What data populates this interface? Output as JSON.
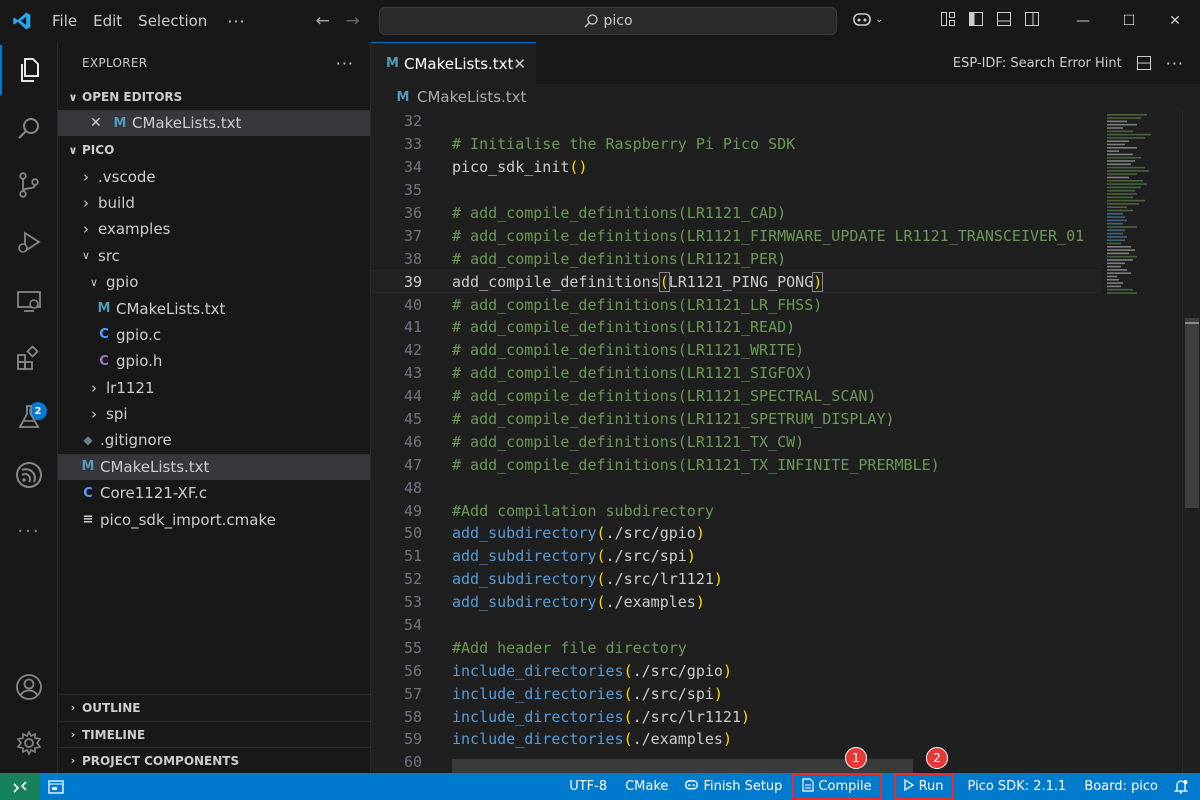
{
  "menu": {
    "file": "File",
    "edit": "Edit",
    "selection": "Selection",
    "more": "···"
  },
  "search": {
    "text": "pico"
  },
  "explorer": {
    "title": "EXPLORER",
    "open_editors": {
      "label": "OPEN EDITORS",
      "items": [
        {
          "name": "CMakeLists.txt",
          "icon": "M"
        }
      ]
    },
    "workspace": {
      "label": "PICO",
      "tree": [
        {
          "name": ".vscode",
          "type": "folder",
          "depth": 0,
          "expanded": false
        },
        {
          "name": "build",
          "type": "folder",
          "depth": 0,
          "expanded": false
        },
        {
          "name": "examples",
          "type": "folder",
          "depth": 0,
          "expanded": false
        },
        {
          "name": "src",
          "type": "folder",
          "depth": 0,
          "expanded": true
        },
        {
          "name": "gpio",
          "type": "folder",
          "depth": 1,
          "expanded": true
        },
        {
          "name": "CMakeLists.txt",
          "type": "file",
          "icon": "M",
          "depth": 2
        },
        {
          "name": "gpio.c",
          "type": "file",
          "icon": "C",
          "depth": 2
        },
        {
          "name": "gpio.h",
          "type": "file",
          "icon": "C",
          "depth": 2
        },
        {
          "name": "lr1121",
          "type": "folder",
          "depth": 1,
          "expanded": false
        },
        {
          "name": "spi",
          "type": "folder",
          "depth": 1,
          "expanded": false
        },
        {
          "name": ".gitignore",
          "type": "file",
          "icon": "git",
          "depth": 0
        },
        {
          "name": "CMakeLists.txt",
          "type": "file",
          "icon": "M",
          "depth": 0,
          "selected": true
        },
        {
          "name": "Core1121-XF.c",
          "type": "file",
          "icon": "C",
          "depth": 0
        },
        {
          "name": "pico_sdk_import.cmake",
          "type": "file",
          "icon": "list",
          "depth": 0
        }
      ]
    },
    "outline": "OUTLINE",
    "timeline": "TIMELINE",
    "project_components": "PROJECT COMPONENTS"
  },
  "editor": {
    "tab": {
      "label": "CMakeLists.txt",
      "icon": "M"
    },
    "esp_hint": "ESP-IDF: Search Error Hint",
    "breadcrumb": "CMakeLists.txt",
    "lines": [
      {
        "n": "32",
        "t": ""
      },
      {
        "n": "33",
        "t": "# Initialise the Raspberry Pi Pico SDK",
        "k": "comment"
      },
      {
        "n": "34",
        "t": "pico_sdk_init()",
        "k": "call",
        "fn": "pico_sdk_init",
        "arg": ""
      },
      {
        "n": "35",
        "t": ""
      },
      {
        "n": "36",
        "t": "# add_compile_definitions(LR1121_CAD)",
        "k": "comment"
      },
      {
        "n": "37",
        "t": "# add_compile_definitions(LR1121_FIRMWARE_UPDATE LR1121_TRANSCEIVER_01",
        "k": "comment"
      },
      {
        "n": "38",
        "t": "# add_compile_definitions(LR1121_PER)",
        "k": "comment"
      },
      {
        "n": "39",
        "t": "add_compile_definitions(LR1121_PING_PONG)",
        "k": "call",
        "fn": "add_compile_definitions",
        "arg": "LR1121_PING_PONG",
        "current": true
      },
      {
        "n": "40",
        "t": "# add_compile_definitions(LR1121_LR_FHSS)",
        "k": "comment"
      },
      {
        "n": "41",
        "t": "# add_compile_definitions(LR1121_READ)",
        "k": "comment"
      },
      {
        "n": "42",
        "t": "# add_compile_definitions(LR1121_WRITE)",
        "k": "comment"
      },
      {
        "n": "43",
        "t": "# add_compile_definitions(LR1121_SIGFOX)",
        "k": "comment"
      },
      {
        "n": "44",
        "t": "# add_compile_definitions(LR1121_SPECTRAL_SCAN)",
        "k": "comment"
      },
      {
        "n": "45",
        "t": "# add_compile_definitions(LR1121_SPETRUM_DISPLAY)",
        "k": "comment"
      },
      {
        "n": "46",
        "t": "# add_compile_definitions(LR1121_TX_CW)",
        "k": "comment"
      },
      {
        "n": "47",
        "t": "# add_compile_definitions(LR1121_TX_INFINITE_PRERMBLE)",
        "k": "comment"
      },
      {
        "n": "48",
        "t": ""
      },
      {
        "n": "49",
        "t": "#Add compilation subdirectory",
        "k": "comment"
      },
      {
        "n": "50",
        "t": "add_subdirectory(./src/gpio)",
        "k": "kwcall",
        "fn": "add_subdirectory",
        "arg": "./src/gpio"
      },
      {
        "n": "51",
        "t": "add_subdirectory(./src/spi)",
        "k": "kwcall",
        "fn": "add_subdirectory",
        "arg": "./src/spi"
      },
      {
        "n": "52",
        "t": "add_subdirectory(./src/lr1121)",
        "k": "kwcall",
        "fn": "add_subdirectory",
        "arg": "./src/lr1121"
      },
      {
        "n": "53",
        "t": "add_subdirectory(./examples)",
        "k": "kwcall",
        "fn": "add_subdirectory",
        "arg": "./examples"
      },
      {
        "n": "54",
        "t": ""
      },
      {
        "n": "55",
        "t": "#Add header file directory",
        "k": "comment"
      },
      {
        "n": "56",
        "t": "include_directories(./src/gpio)",
        "k": "kwcall",
        "fn": "include_directories",
        "arg": "./src/gpio"
      },
      {
        "n": "57",
        "t": "include_directories(./src/spi)",
        "k": "kwcall",
        "fn": "include_directories",
        "arg": "./src/spi"
      },
      {
        "n": "58",
        "t": "include_directories(./src/lr1121)",
        "k": "kwcall",
        "fn": "include_directories",
        "arg": "./src/lr1121"
      },
      {
        "n": "59",
        "t": "include_directories(./examples)",
        "k": "kwcall",
        "fn": "include_directories",
        "arg": "./examples"
      },
      {
        "n": "60",
        "t": ""
      }
    ]
  },
  "status": {
    "encoding": "UTF-8",
    "language": "CMake",
    "finish_setup": "Finish Setup",
    "compile": "Compile",
    "run": "Run",
    "pico_sdk": "Pico SDK: 2.1.1",
    "board": "Board: pico",
    "compile_marker": "1",
    "run_marker": "2"
  },
  "extensions_badge": "2",
  "colors": {
    "accent": "#0078d4",
    "statusbar": "#007acc",
    "highlight_box": "#e03030"
  }
}
